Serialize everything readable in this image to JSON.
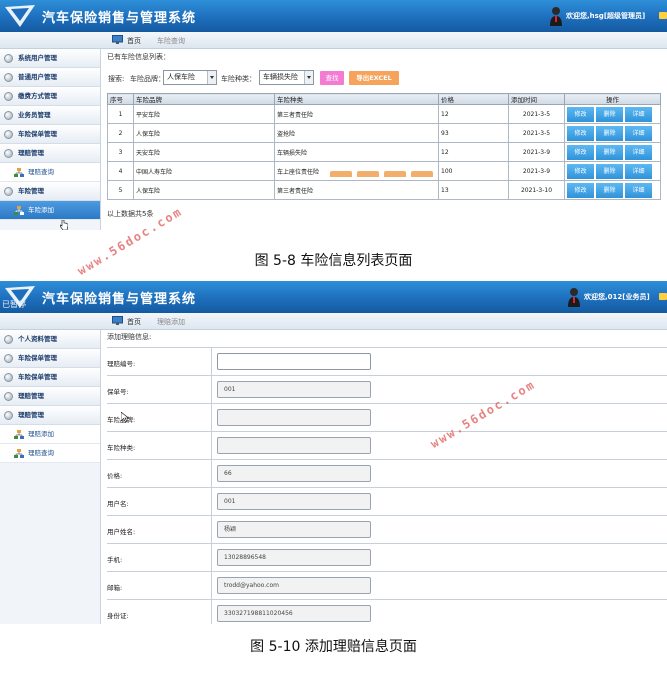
{
  "app": {
    "title": "汽车保险销售与管理系统"
  },
  "screen1": {
    "user_text": "欢迎您,hsg[超级管理员]",
    "nav": {
      "home": "首页",
      "current_tab": "车险查询"
    },
    "sidebar": {
      "items": [
        {
          "label": "系统用户管理"
        },
        {
          "label": "普通用户管理"
        },
        {
          "label": "缴费方式管理"
        },
        {
          "label": "业务员管理"
        },
        {
          "label": "车险保单管理"
        },
        {
          "label": "理赔管理"
        },
        {
          "label": "理赔查询",
          "sub": true
        },
        {
          "label": "车险管理"
        },
        {
          "label": "车险添加",
          "sub": true,
          "active": true
        }
      ]
    },
    "list_title": "已有车险信息列表：",
    "filter": {
      "label": "搜索:",
      "brand_label": "车险品牌：",
      "brand_value": "人保车险",
      "type_label": "车险种类：",
      "type_value": "车辆损失险",
      "search_button": "查找",
      "export_button": "导出EXCEL"
    },
    "table": {
      "columns": [
        "序号",
        "车险品牌",
        "车险种类",
        "价格",
        "添加时间",
        "操作"
      ],
      "rows": [
        {
          "id": "1",
          "brand": "平安车险",
          "type": "第三者责任险",
          "price": "12",
          "date": "2021-3-5"
        },
        {
          "id": "2",
          "brand": "人保车险",
          "type": "盗抢险",
          "price": "93",
          "date": "2021-3-5"
        },
        {
          "id": "3",
          "brand": "天安车险",
          "type": "车辆损失险",
          "price": "12",
          "date": "2021-3-9"
        },
        {
          "id": "4",
          "brand": "中国人寿车险",
          "type": "车上座位责任险",
          "price": "100",
          "date": "2021-3-9"
        },
        {
          "id": "5",
          "brand": "人保车险",
          "type": "第三者责任险",
          "price": "13",
          "date": "2021-3-10"
        }
      ],
      "actions": {
        "edit": "修改",
        "delete": "删除",
        "detail": "详细"
      }
    },
    "count_text": "以上数据共5条"
  },
  "screen2": {
    "paused_label": "已暂停",
    "user_text": "欢迎您,012[业务员]",
    "nav": {
      "home": "首页",
      "current_tab": "理赔添加"
    },
    "sidebar": {
      "items": [
        {
          "label": "个人资料管理"
        },
        {
          "label": "车险保单管理"
        },
        {
          "label": "车险保单管理"
        },
        {
          "label": "理赔管理"
        },
        {
          "label": "理赔管理"
        },
        {
          "label": "理赔添加",
          "sub": true
        },
        {
          "label": "理赔查询",
          "sub": true
        }
      ]
    },
    "form_title": "添加理赔信息:",
    "fields": [
      {
        "label": "理赔编号:",
        "value": "",
        "editable": true
      },
      {
        "label": "保单号:",
        "value": "001"
      },
      {
        "label": "车险品牌:",
        "value": ""
      },
      {
        "label": "车险种类:",
        "value": ""
      },
      {
        "label": "价格:",
        "value": "66"
      },
      {
        "label": "用户名:",
        "value": "001"
      },
      {
        "label": "用户姓名:",
        "value": "杨颖"
      },
      {
        "label": "手机:",
        "value": "13028896548"
      },
      {
        "label": "邮箱:",
        "value": "trodd@yahoo.com"
      },
      {
        "label": "身份证:",
        "value": "330327198811020456"
      }
    ]
  },
  "watermark": "www.56doc.com",
  "captions": {
    "fig1": "图 5-8 车险信息列表页面",
    "fig2": "图 5-10 添加理赔信息页面"
  },
  "colors": {
    "header_blue": "#1d6fbd",
    "search_pink": "#f37bd1",
    "export_orange": "#f6a35b",
    "action_blue": "#2f93d9",
    "watermark_red": "#e05a5a"
  }
}
